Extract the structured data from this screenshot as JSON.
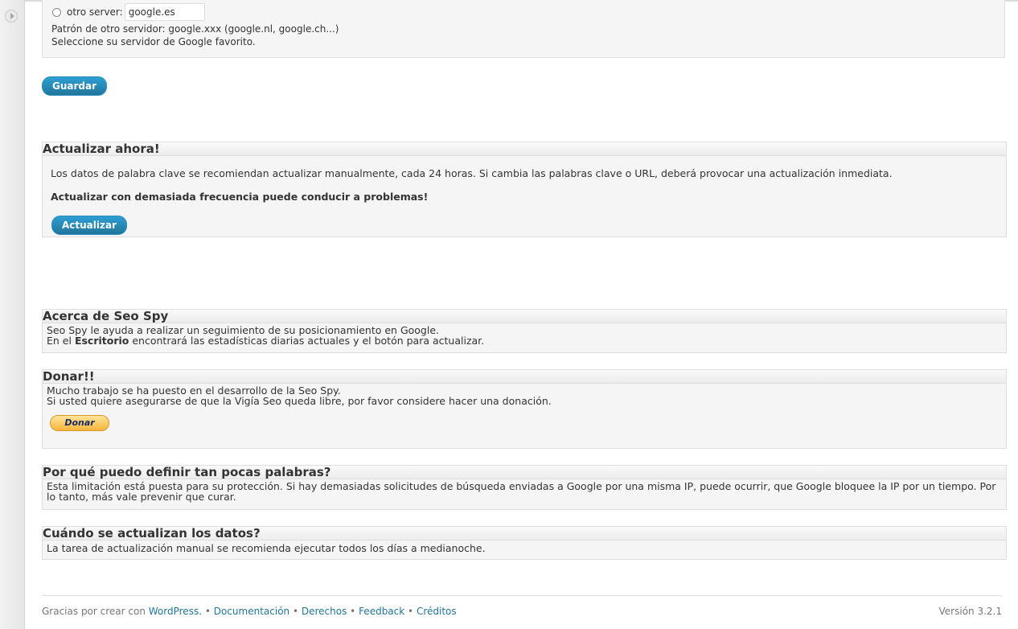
{
  "server": {
    "radio_label": "otro server:",
    "input_value": "google.es",
    "pattern_text": "Patrón de otro servidor: google.xxx (google.nl, google.ch...)",
    "help_text": "Seleccione su servidor de Google favorito."
  },
  "save_button": "Guardar",
  "update_box": {
    "title": "Actualizar ahora!",
    "description": "Los datos de palabra clave se recomiendan actualizar manualmente, cada 24 horas. Si cambia las palabras clave o URL, deberá provocar una actualización inmediata.",
    "warning": "Actualizar con demasiada frecuencia puede conducir a problemas!",
    "button": "Actualizar"
  },
  "about_box": {
    "title": "Acerca de Seo Spy",
    "line1": "Seo Spy le ayuda a realizar un seguimiento de su posicionamiento en Google.",
    "line2_prefix": "En el ",
    "line2_bold": "Escritorio",
    "line2_suffix": " encontrará las estadísticas diarias actuales y el botón para actualizar."
  },
  "donate_box": {
    "title": "Donar!!",
    "line1": "Mucho trabajo se ha puesto en el desarrollo de la Seo Spy.",
    "line2": "Si usted quiere asegurarse de que la Vigía Seo queda libre, por favor considere hacer una donación.",
    "button": "Donar"
  },
  "why_box": {
    "title": "Por qué puedo definir tan pocas palabras?",
    "text": "Esta limitación está puesta para su protección. Si hay demasiadas solicitudes de búsqueda enviadas a Google por una misma IP, puede ocurrir, que Google bloquee la IP por un tiempo. Por lo tanto, más vale prevenir que curar."
  },
  "when_box": {
    "title": "Cuándo se actualizan los datos?",
    "text": "La tarea de actualización manual se recomienda ejecutar todos los días a medianoche."
  },
  "footer": {
    "thanks": "Gracias por crear con ",
    "wordpress": "WordPress.",
    "sep": " • ",
    "documentation": "Documentación",
    "rights": "Derechos",
    "feedback": "Feedback",
    "credits": "Créditos",
    "version": "Versión 3.2.1"
  },
  "colors": {
    "link": "#21759b",
    "button_primary": "#21759b",
    "box_background": "#f5f5f5"
  }
}
